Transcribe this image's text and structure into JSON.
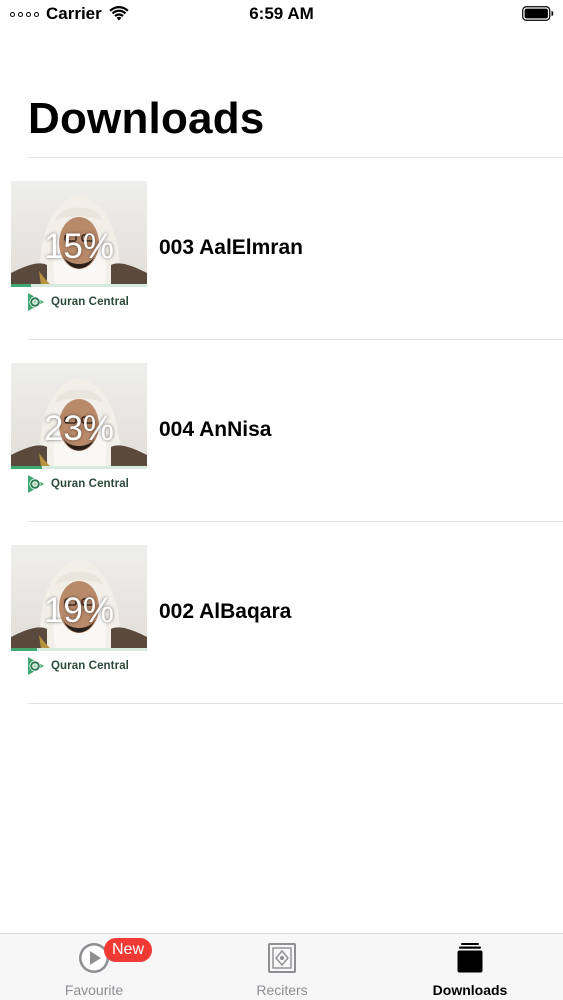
{
  "status_bar": {
    "carrier": "Carrier",
    "time": "6:59 AM"
  },
  "page": {
    "title": "Downloads"
  },
  "downloads": [
    {
      "title": "003 AalElmran",
      "percent_label": "15%",
      "progress": 0.15,
      "brand": "Quran Central"
    },
    {
      "title": "004 AnNisa",
      "percent_label": "23%",
      "progress": 0.23,
      "brand": "Quran Central"
    },
    {
      "title": "002 AlBaqara",
      "percent_label": "19%",
      "progress": 0.19,
      "brand": "Quran Central"
    }
  ],
  "tab_bar": {
    "tabs": [
      {
        "label": "Favourite",
        "icon": "play-circle-icon",
        "badge": "New",
        "active": false
      },
      {
        "label": "Reciters",
        "icon": "reciters-icon",
        "active": false
      },
      {
        "label": "Downloads",
        "icon": "downloads-stack-icon",
        "active": true
      }
    ]
  },
  "colors": {
    "progress": "#3fa873",
    "badge": "#f23a35",
    "tab_inactive": "#8e8e93"
  }
}
